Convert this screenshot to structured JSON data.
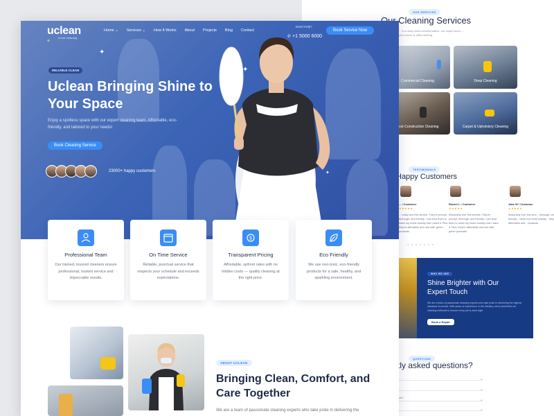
{
  "back_page": {
    "services": {
      "pill": "OUR SERVICES",
      "title": "Our Cleaning Services",
      "description": "... to a deep clean transformation, our expert touch ... your home or office shining.",
      "tiles": [
        "Commercial Cleaning",
        "Deep Cleaning",
        "Post-Construction Cleaning",
        "Carpet & Upholstery Cleaning"
      ]
    },
    "testimonials": {
      "pill": "TESTIMONIALS",
      "title": "Happy Customers",
      "cards": [
        {
          "name": "... / Customer",
          "stars": "★★★★★",
          "text": "... really love this service. They're prompt, thorough, and friendly. I can trust them to leave my home exactly how I want it. Plus, they're affordable and use safe, green products."
        },
        {
          "name": "Robert L / Customer",
          "stars": "★★★★★",
          "text": "Absolutely love this service. They're prompt, thorough, and friendly. I can trust them to clean my home exactly how I want it. Plus, they're affordable and use safe, green products!"
        },
        {
          "name": "Jake W / Customer",
          "stars": "★★★★★",
          "text": "Absolutely love this serv... thorough, and friendly... clean my home exactly... they're affordable and... products."
        }
      ],
      "dots": "● ● ● ● ● ● ●"
    },
    "shine": {
      "pill": "WHO WE ARE",
      "title": "Shine Brighter with Our Expert Touch",
      "description": "We are a team of passionate cleaning experts who take pride in delivering the highest standard of service. With years of experience in the industry, we've perfected our cleaning methods to ensure every job is done right.",
      "button": "Book a Repair"
    },
    "faq": {
      "pill": "QUESTIONS",
      "title": "...tly asked questions?",
      "questions": [
        "...",
        "...",
        "...vice?",
        "...",
        "..."
      ]
    }
  },
  "front_page": {
    "logo": {
      "word": "uclean",
      "sub": "house cleaning"
    },
    "nav": [
      "Home ⌄",
      "Services ⌄",
      "How It Works",
      "About",
      "Projects",
      "Blog",
      "Contact"
    ],
    "help": {
      "label": "Need Help?",
      "phone": "+1 5000 6000"
    },
    "book_now": "Book Service Now",
    "hero": {
      "badge": "RELIABLE CLEAN",
      "title": "Uclean Bringing Shine to Your Space",
      "description": "Enjoy a spotless space with our expert cleaning team. Affordable, eco-friendly, and tailored to your needs!",
      "button": "Book Cleaning Service",
      "customers": "23000+ happy customers"
    },
    "features": [
      {
        "title": "Professional Team",
        "text": "Our trained, insured cleaners ensure professional, trusted service and impeccable results."
      },
      {
        "title": "On Time Service",
        "text": "Reliable, punctual service that respects your schedule and exceeds expectations."
      },
      {
        "title": "Transparent Pricing",
        "text": "Affordable, upfront rates with no hidden costs — quality cleaning at the right price."
      },
      {
        "title": "Eco Friendly",
        "text": "We use non-toxic, eco-friendly products for a safe, healthy, and sparkling environment."
      }
    ],
    "about": {
      "pill": "ABOUT UCLEAN",
      "title": "Bringing Clean, Comfort, and Care Together",
      "description": "We are a team of passionate cleaning experts who take pride in delivering the"
    }
  },
  "colors": {
    "primary": "#3a8df6",
    "hero": "#3c64b6",
    "navy": "#173a84",
    "heading": "#1e2b47"
  }
}
